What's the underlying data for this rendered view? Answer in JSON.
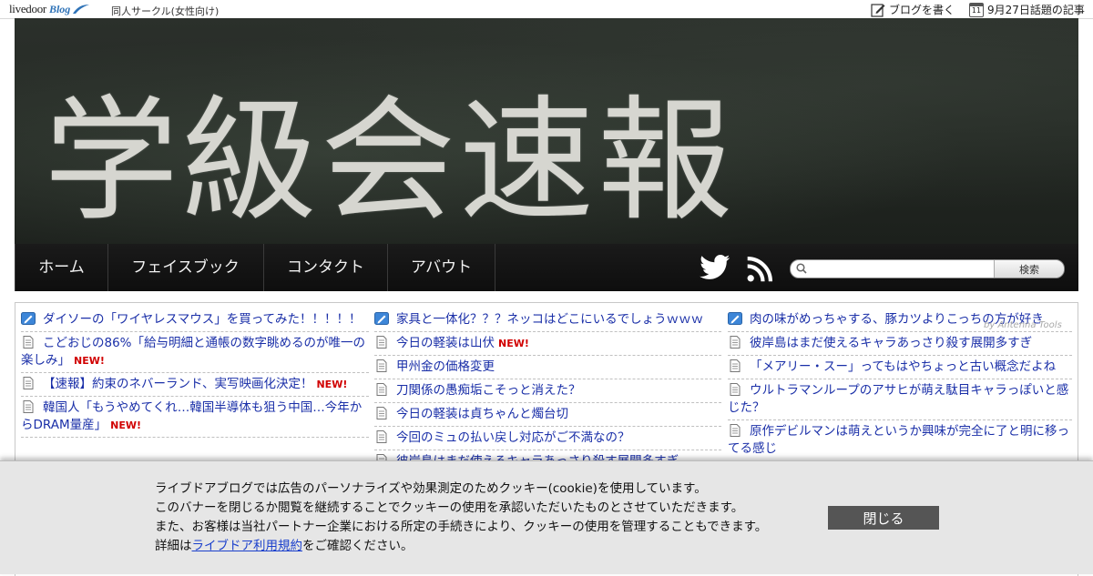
{
  "topbar": {
    "logo_text": "livedoor",
    "logo_blog": "Blog",
    "category": "同人サークル(女性向け)",
    "write_blog": "ブログを書く",
    "calendar_day": "11",
    "topics": "9月27日話題の記事"
  },
  "header": {
    "title": "学級会速報"
  },
  "nav": {
    "items": [
      "ホーム",
      "フェイスブック",
      "コンタクト",
      "アバウト"
    ],
    "search_button": "検索",
    "search_placeholder": ""
  },
  "articles": {
    "col1": [
      {
        "title": "ダイソーの「ワイヤレスマウス」を買ってみた！！！！！",
        "new": "",
        "icon": "pen-icon"
      },
      {
        "title": "こどおじの86%「給与明細と通帳の数字眺めるのが唯一の楽しみ」",
        "new": "NEW!",
        "icon": "document-icon"
      },
      {
        "title": "【速報】約束のネバーランド、実写映画化決定！",
        "new": "NEW!",
        "icon": "document-icon"
      },
      {
        "title": "韓国人「もうやめてくれ…韓国半導体も狙う中国…今年からDRAM量産」",
        "new": "NEW!",
        "icon": "document-icon"
      }
    ],
    "col2": [
      {
        "title": "家具と一体化？？？ネッコはどこにいるでしょうｗｗｗ",
        "new": "",
        "icon": "pen-icon"
      },
      {
        "title": "今日の軽装は山伏",
        "new": "NEW!",
        "icon": "document-icon"
      },
      {
        "title": "甲州金の価格変更",
        "new": "",
        "icon": "document-icon"
      },
      {
        "title": "刀関係の愚痴垢こそっと消えた？",
        "new": "",
        "icon": "document-icon"
      },
      {
        "title": "今日の軽装は貞ちゃんと燭台切",
        "new": "",
        "icon": "document-icon"
      },
      {
        "title": "今回のミュの払い戻し対応がご不満なの？",
        "new": "",
        "icon": "document-icon"
      },
      {
        "title": "彼岸島はまだ使えるキャラあっさり殺す展開多すぎ",
        "new": "",
        "icon": "document-icon"
      }
    ],
    "col3": [
      {
        "title": "肉の味がめっちゃする、豚カツよりこっちの方が好き",
        "new": "",
        "icon": "pen-icon"
      },
      {
        "title": "彼岸島はまだ使えるキャラあっさり殺す展開多すぎ",
        "new": "",
        "icon": "document-icon"
      },
      {
        "title": "「メアリー・スー」ってもはやちょっと古い概念だよね",
        "new": "",
        "icon": "document-icon"
      },
      {
        "title": "ウルトラマンループのアサヒが萌え駄目キャラっぽいと感じた？",
        "new": "",
        "icon": "document-icon"
      },
      {
        "title": "原作デビルマンは萌えというか興味が完全に了と明に移ってる感じ",
        "new": "",
        "icon": "document-icon"
      }
    ],
    "watermark": "by Antenna Tools"
  },
  "cookie": {
    "line1": "ライブドアブログでは広告のパーソナライズや効果測定のためクッキー(cookie)を使用しています。",
    "line2": "このバナーを閉じるか閲覧を継続することでクッキーの使用を承認いただいたものとさせていただきます。",
    "line3": "また、お客様は当社パートナー企業における所定の手続きにより、クッキーの使用を管理することもできます。",
    "line4_prefix": "詳細は",
    "line4_link": "ライブドア利用規約",
    "line4_suffix": "をご確認ください。",
    "close": "閉じる"
  },
  "colors": {
    "link": "#1a2fa8",
    "new_badge": "#d10000",
    "nav_bg": "#111111",
    "close_button": "#555555"
  }
}
